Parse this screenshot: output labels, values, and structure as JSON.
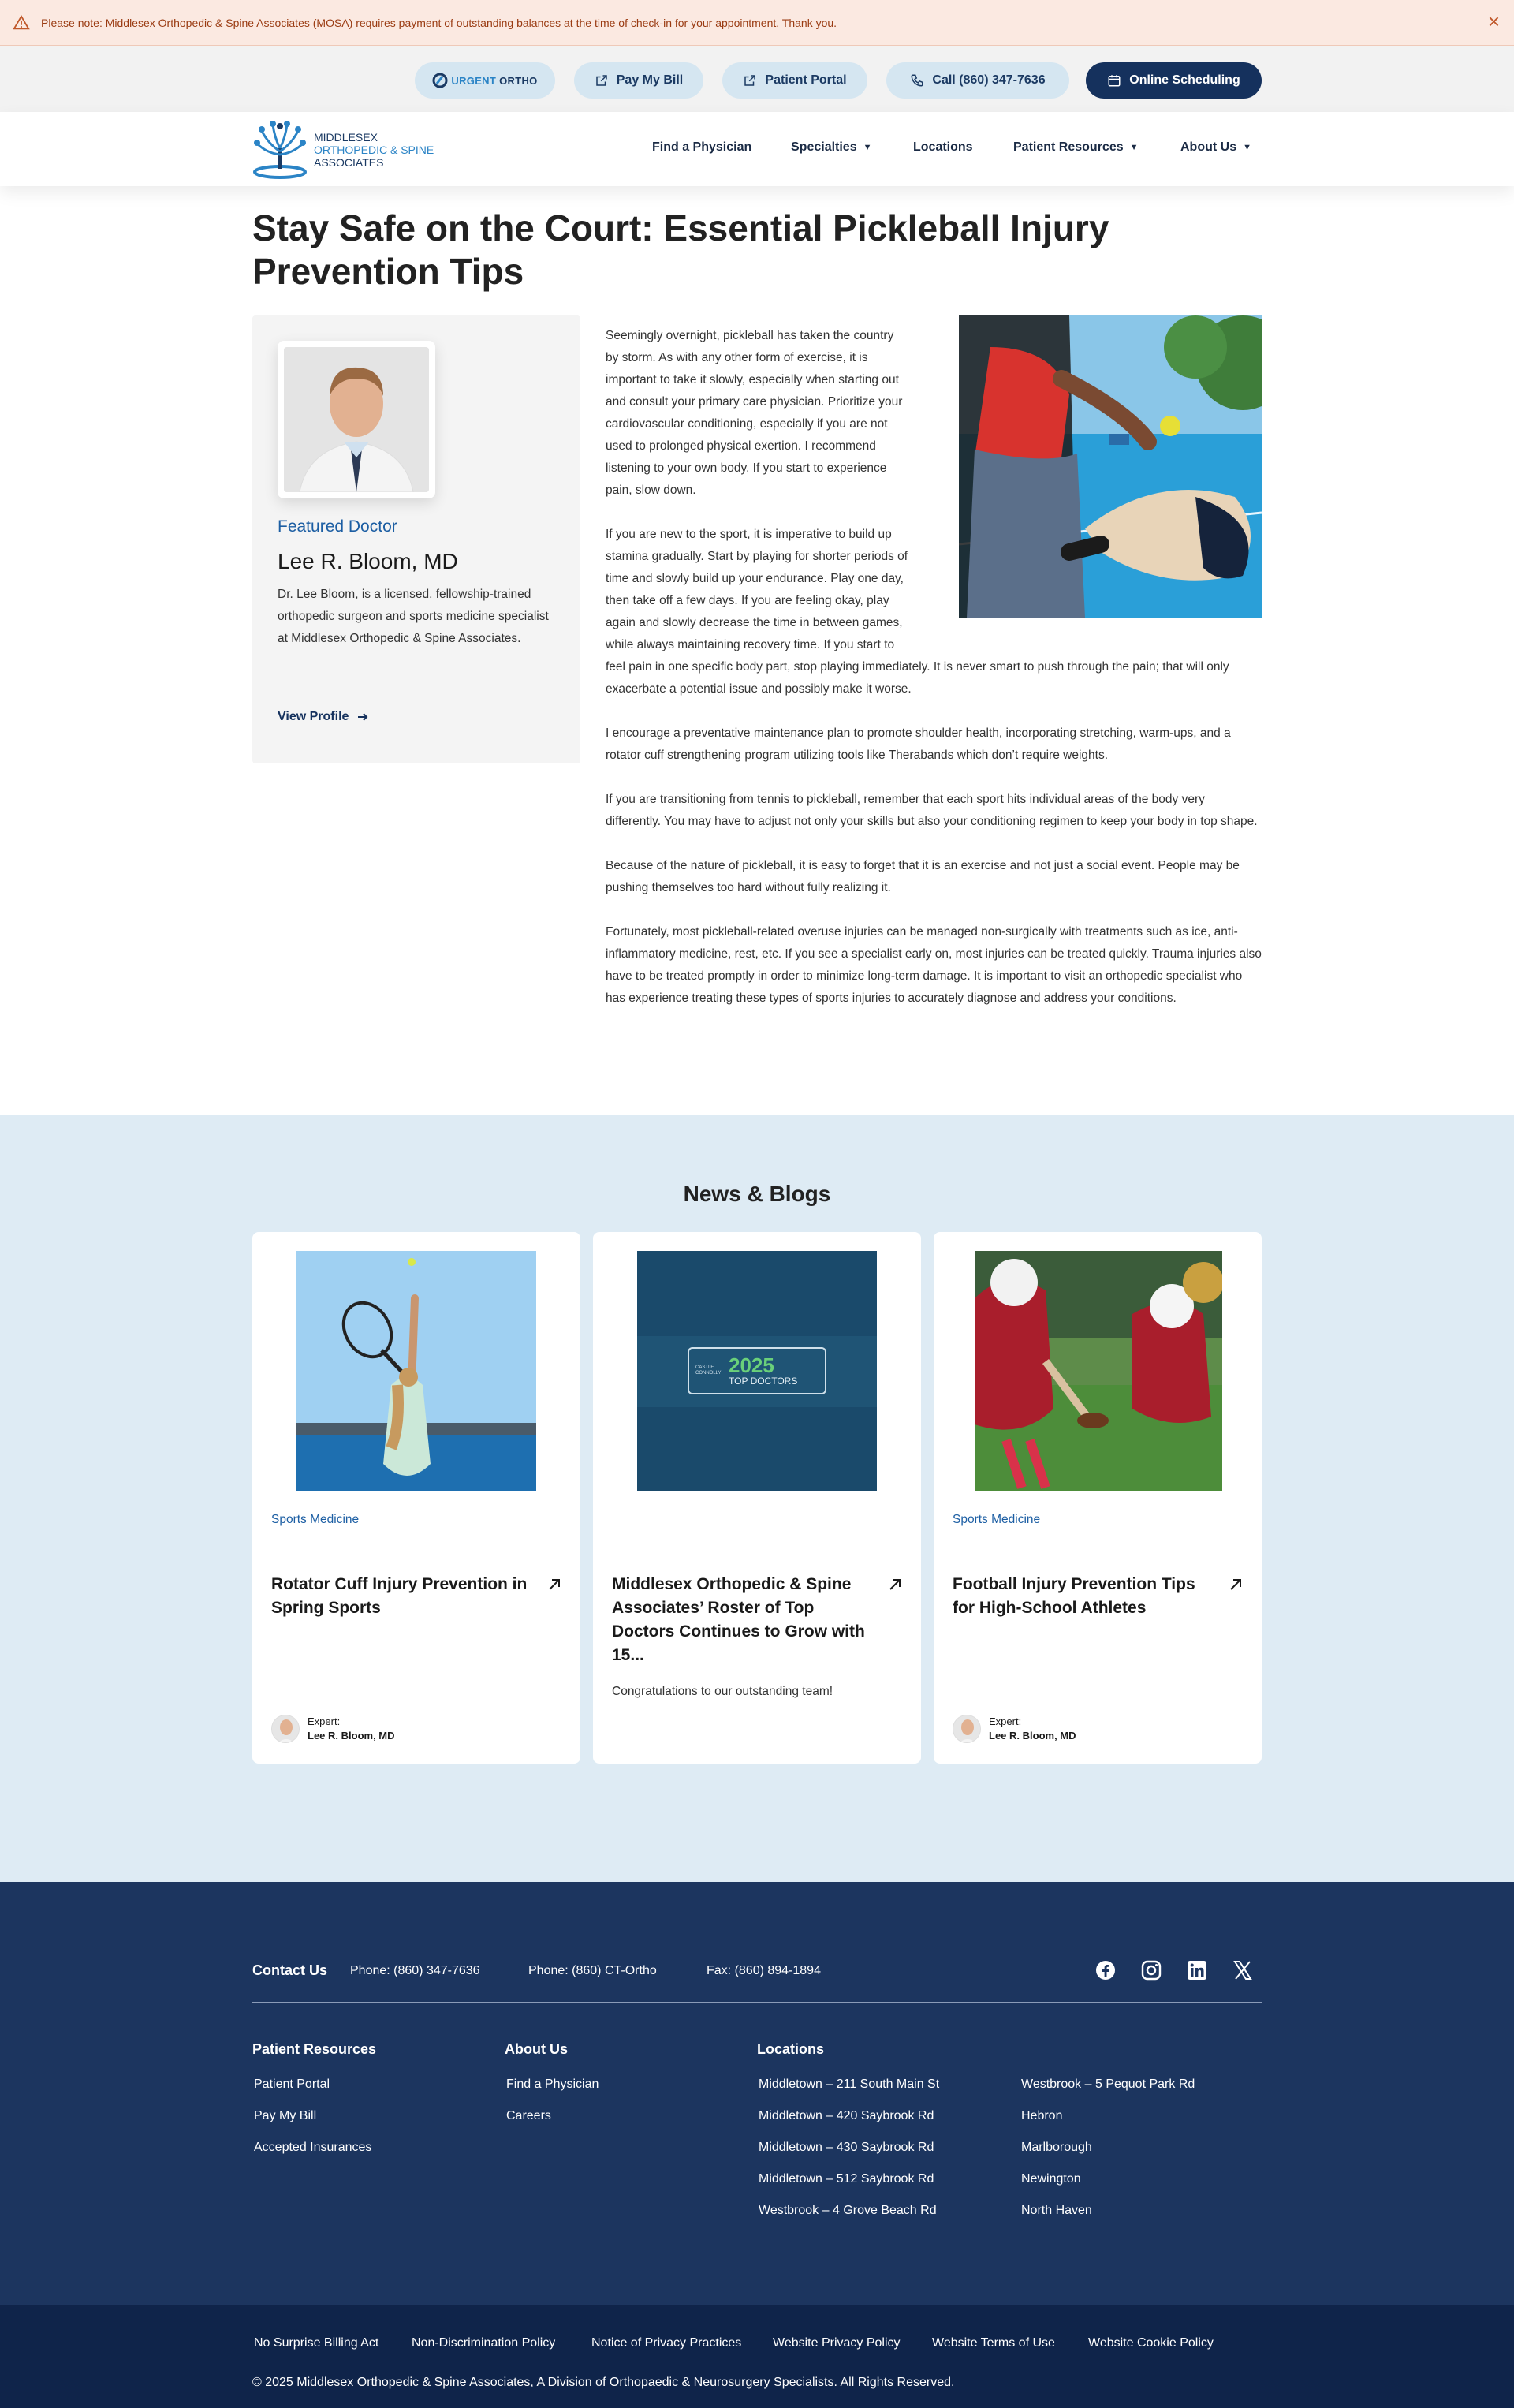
{
  "alert": {
    "text": "Please note: Middlesex Orthopedic & Spine Associates (MOSA) requires payment of outstanding balances at the time of check-in for your appointment. Thank you.",
    "close": "×"
  },
  "utility": {
    "urgent_a": "URGENT",
    "urgent_b": "ORTHO",
    "pay_bill": "Pay My Bill",
    "patient_portal": "Patient Portal",
    "call": "Call (860) 347-7636",
    "online_scheduling": "Online Scheduling"
  },
  "header": {
    "logo_line1": "MIDDLESEX",
    "logo_line2": "ORTHOPEDIC & SPINE",
    "logo_line3": "ASSOCIATES",
    "nav": {
      "find_physician": "Find a Physician",
      "specialties": "Specialties",
      "locations": "Locations",
      "patient_resources": "Patient Resources",
      "about_us": "About Us"
    }
  },
  "page": {
    "title": "Stay Safe on the Court: Essential Pickleball Injury Prevention Tips"
  },
  "doctor": {
    "featured": "Featured Doctor",
    "name": "Lee R. Bloom, MD",
    "bio": "Dr. Lee Bloom, is a licensed, fellowship-trained orthopedic surgeon and sports medicine specialist at Middlesex Orthopedic & Spine Associates.",
    "view_profile": "View Profile"
  },
  "article": {
    "p1": "Seemingly overnight, pickleball has taken the country by storm. As with any other form of exercise, it is important to take it slowly, especially when starting out and consult your primary care physician. Prioritize your cardiovascular conditioning, especially if you are not used to prolonged physical exertion. I recommend listening to your own body. If you start to experience pain, slow down.",
    "p2": "If you are new to the sport, it is imperative to build up stamina gradually. Start by playing for shorter periods of time and slowly build up your endurance. Play one day, then take off a few days. If you are feeling okay, play again and slowly decrease the time in between games, while always maintaining recovery time. If you start to feel pain in one specific body part, stop playing immediately. It is never smart to push through the pain; that will only exacerbate a potential issue and possibly make it worse.",
    "p3": "I encourage a preventative maintenance plan to promote shoulder health, incorporating stretching, warm-ups, and a rotator cuff strengthening program utilizing tools like Therabands which don’t require weights.",
    "p4": "If you are transitioning from tennis to pickleball, remember that each sport hits individual areas of the body very differently. You may have to adjust not only your skills but also your conditioning regimen to keep your body in top shape.",
    "p5": "Because of the nature of pickleball, it is easy to forget that it is an exercise and not just a social event. People may be pushing themselves too hard without fully realizing it.",
    "p6": "Fortunately, most pickleball-related overuse injuries can be managed non-surgically with treatments such as ice, anti-inflammatory medicine, rest, etc. If you see a specialist early on, most injuries can be treated quickly. Trauma injuries also have to be treated promptly in order to minimize long-term damage. It is important to visit an orthopedic specialist who has experience treating these types of sports injuries to accurately diagnose and address your conditions."
  },
  "news": {
    "title": "News & Blogs",
    "cards": [
      {
        "category": "Sports Medicine",
        "title": "Rotator Cuff Injury Prevention in Spring Sports",
        "expert_label": "Expert:",
        "expert_name": "Lee R. Bloom, MD"
      },
      {
        "badge_top": "CASTLE CONNOLLY",
        "badge_year": "2025",
        "badge_text": "TOP DOCTORS",
        "title": "Middlesex Orthopedic & Spine Associates’ Roster of Top Doctors Continues to Grow with 15...",
        "excerpt": "Congratulations to our outstanding team!"
      },
      {
        "category": "Sports Medicine",
        "title": "Football Injury Prevention Tips for High-School Athletes",
        "expert_label": "Expert:",
        "expert_name": "Lee R. Bloom, MD"
      }
    ]
  },
  "footer": {
    "contact_us": "Contact Us",
    "phone1": "Phone: (860) 347-7636",
    "phone2": "Phone: (860) CT-Ortho",
    "fax": "Fax: (860) 894-1894",
    "patient_resources": {
      "heading": "Patient Resources",
      "links": [
        "Patient Portal",
        "Pay My Bill",
        "Accepted Insurances"
      ]
    },
    "about_us": {
      "heading": "About Us",
      "links": [
        "Find a Physician",
        "Careers"
      ]
    },
    "locations": {
      "heading": "Locations",
      "col1": [
        "Middletown – 211 South Main St",
        "Middletown – 420 Saybrook Rd",
        "Middletown – 430 Saybrook Rd",
        "Middletown – 512 Saybrook Rd",
        "Westbrook – 4 Grove Beach Rd"
      ],
      "col2": [
        "Westbrook – 5 Pequot Park Rd",
        "Hebron",
        "Marlborough",
        "Newington",
        "North Haven"
      ]
    }
  },
  "subfooter": {
    "links": [
      "No Surprise Billing Act",
      "Non-Discrimination Policy",
      "Notice of Privacy Practices",
      "Website Privacy Policy",
      "Website Terms of Use",
      "Website Cookie Policy"
    ],
    "copyright": "© 2025 Middlesex Orthopedic & Spine Associates, A Division of Orthopaedic & Neurosurgery Specialists. All Rights Reserved."
  },
  "colors": {
    "navy": "#15315d",
    "accent_blue": "#1c5ea3",
    "alert_bg": "#fbe9e1",
    "news_bg": "#deebf4",
    "footer_bg": "#1c355f"
  }
}
